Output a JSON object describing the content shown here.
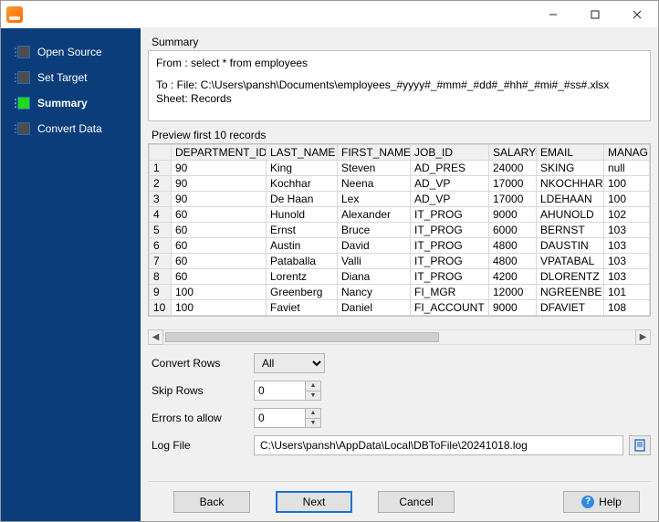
{
  "window": {
    "title": ""
  },
  "sidebar": {
    "steps": [
      {
        "label": "Open Source"
      },
      {
        "label": "Set Target"
      },
      {
        "label": "Summary"
      },
      {
        "label": "Convert Data"
      }
    ]
  },
  "summary": {
    "title": "Summary",
    "from": "From : select * from employees",
    "to": "To : File: C:\\Users\\pansh\\Documents\\employees_#yyyy#_#mm#_#dd#_#hh#_#mi#_#ss#.xlsx Sheet: Records"
  },
  "preview": {
    "title": "Preview first 10 records",
    "columns": [
      "",
      "DEPARTMENT_ID",
      "LAST_NAME",
      "FIRST_NAME",
      "JOB_ID",
      "SALARY",
      "EMAIL",
      "MANAG"
    ],
    "rows": [
      [
        "1",
        "90",
        "King",
        "Steven",
        "AD_PRES",
        "24000",
        "SKING",
        "null"
      ],
      [
        "2",
        "90",
        "Kochhar",
        "Neena",
        "AD_VP",
        "17000",
        "NKOCHHAR",
        "100"
      ],
      [
        "3",
        "90",
        "De Haan",
        "Lex",
        "AD_VP",
        "17000",
        "LDEHAAN",
        "100"
      ],
      [
        "4",
        "60",
        "Hunold",
        "Alexander",
        "IT_PROG",
        "9000",
        "AHUNOLD",
        "102"
      ],
      [
        "5",
        "60",
        "Ernst",
        "Bruce",
        "IT_PROG",
        "6000",
        "BERNST",
        "103"
      ],
      [
        "6",
        "60",
        "Austin",
        "David",
        "IT_PROG",
        "4800",
        "DAUSTIN",
        "103"
      ],
      [
        "7",
        "60",
        "Pataballa",
        "Valli",
        "IT_PROG",
        "4800",
        "VPATABAL",
        "103"
      ],
      [
        "8",
        "60",
        "Lorentz",
        "Diana",
        "IT_PROG",
        "4200",
        "DLORENTZ",
        "103"
      ],
      [
        "9",
        "100",
        "Greenberg",
        "Nancy",
        "FI_MGR",
        "12000",
        "NGREENBE",
        "101"
      ],
      [
        "10",
        "100",
        "Faviet",
        "Daniel",
        "FI_ACCOUNT",
        "9000",
        "DFAVIET",
        "108"
      ]
    ]
  },
  "options": {
    "convert_rows_label": "Convert Rows",
    "convert_rows_value": "All",
    "skip_rows_label": "Skip Rows",
    "skip_rows_value": "0",
    "errors_label": "Errors to allow",
    "errors_value": "0",
    "log_file_label": "Log File",
    "log_file_value": "C:\\Users\\pansh\\AppData\\Local\\DBToFile\\20241018.log"
  },
  "footer": {
    "back": "Back",
    "next": "Next",
    "cancel": "Cancel",
    "help": "Help"
  }
}
